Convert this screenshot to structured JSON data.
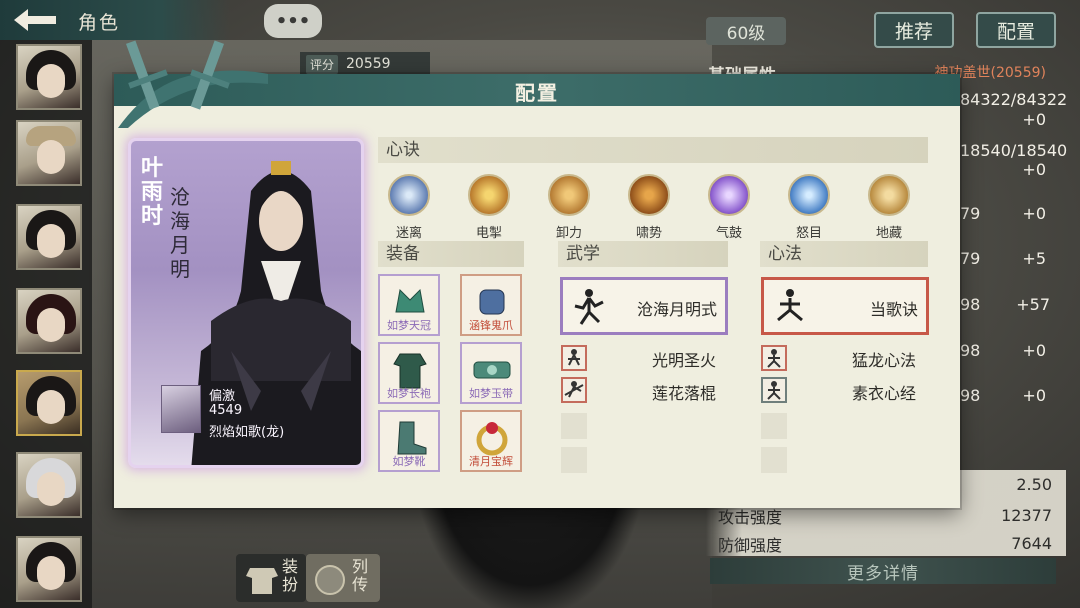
{
  "header": {
    "title": "角色"
  },
  "chat_bubble": "•••",
  "score": {
    "label": "评分",
    "value": "20559"
  },
  "level": "60级",
  "top_buttons": {
    "recommend": "推荐",
    "configure": "配置"
  },
  "stats": {
    "heading": "基础属性",
    "hint": "神功盖世(20559)",
    "rows": [
      {
        "value": "84322/84322",
        "extra": "+0"
      },
      {
        "value": "18540/18540",
        "extra": "+0"
      },
      {
        "value": "79",
        "extra": "+0"
      },
      {
        "value": "79",
        "extra": "+5"
      },
      {
        "value": "98",
        "extra": "+57"
      },
      {
        "value": "98",
        "extra": "+0"
      },
      {
        "value": "98",
        "extra": "+0"
      }
    ],
    "crit_multiplier": "2.50",
    "attack_label": "攻击强度",
    "attack_value": "12377",
    "defense_label": "防御强度",
    "defense_value": "7644",
    "more_details": "更多详情"
  },
  "bottom_tabs": {
    "outfit": "装扮",
    "biography": "列传"
  },
  "modal": {
    "title": "配置",
    "character": {
      "name": "叶雨时",
      "title": "沧海月明",
      "info": {
        "type": "偏激",
        "power": "4549",
        "tag": "烈焰如歌(龙)"
      }
    },
    "sections": {
      "mind": "心诀",
      "equipment": "装备",
      "martial": "武学",
      "heart": "心法"
    },
    "mind_skills": [
      {
        "label": "迷离",
        "icon": "mist-icon"
      },
      {
        "label": "电掣",
        "icon": "lightning-icon"
      },
      {
        "label": "卸力",
        "icon": "deflect-icon"
      },
      {
        "label": "啸势",
        "icon": "roar-icon"
      },
      {
        "label": "气鼓",
        "icon": "qi-icon"
      },
      {
        "label": "怒目",
        "icon": "glare-icon"
      },
      {
        "label": "地藏",
        "icon": "earth-icon"
      }
    ],
    "equipment": [
      {
        "label": "如梦天冠",
        "icon": "crown-icon"
      },
      {
        "label": "涵锋鬼爪",
        "icon": "gauntlet-icon"
      },
      {
        "label": "如梦长袍",
        "icon": "robe-icon"
      },
      {
        "label": "如梦玉带",
        "icon": "belt-icon"
      },
      {
        "label": "如梦靴",
        "icon": "boots-icon"
      },
      {
        "label": "清月宝辉",
        "icon": "ring-icon"
      }
    ],
    "martial": {
      "main": "沧海月明式",
      "sub": [
        "光明圣火",
        "莲花落棍"
      ]
    },
    "heart": {
      "main": "当歌诀",
      "sub": [
        "猛龙心法",
        "素衣心经"
      ]
    }
  }
}
